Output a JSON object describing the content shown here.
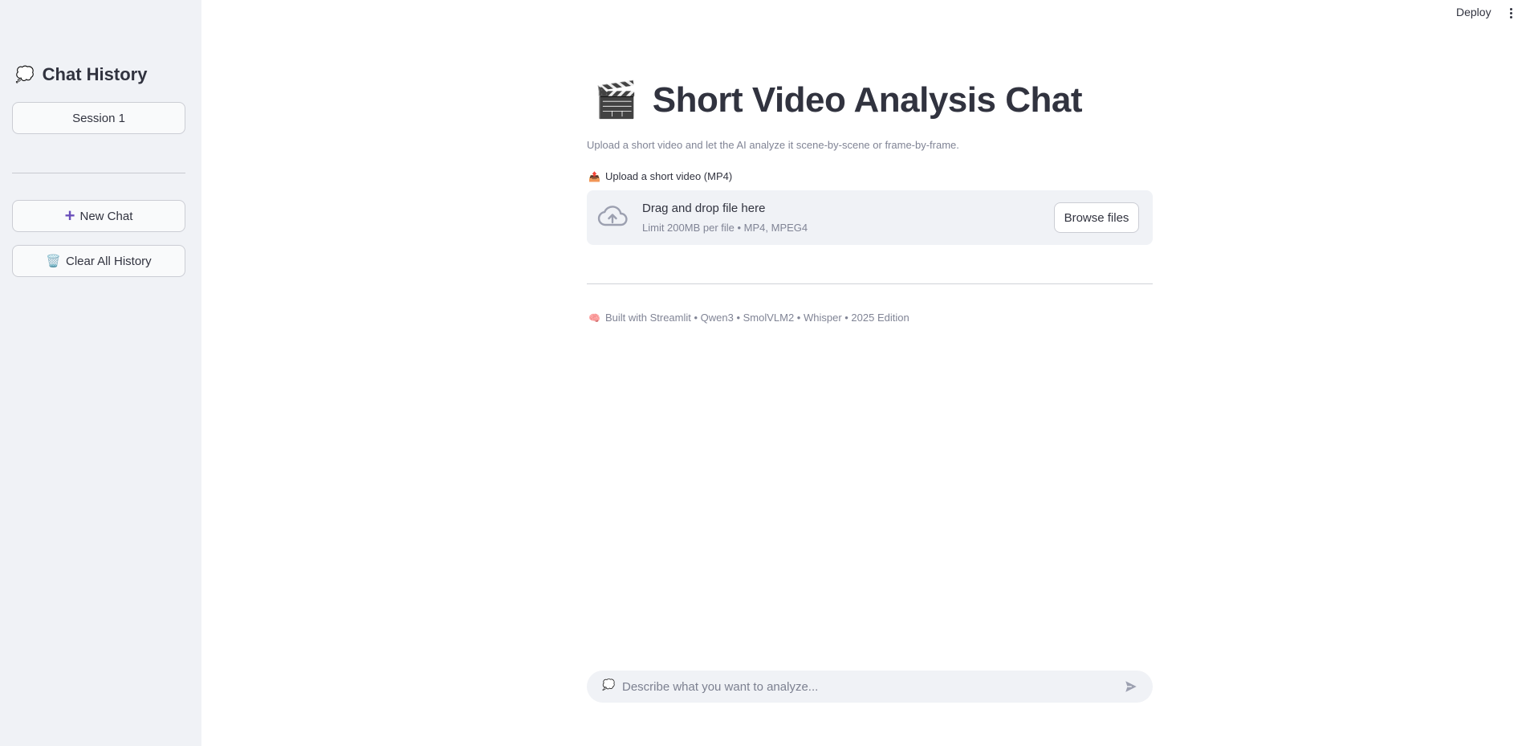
{
  "header": {
    "deploy_label": "Deploy"
  },
  "sidebar": {
    "title_emoji": "💭",
    "title": "Chat History",
    "sessions": [
      {
        "label": "Session 1"
      }
    ],
    "new_chat_label": "New Chat",
    "clear_history_emoji": "🗑️",
    "clear_history_label": "Clear All History"
  },
  "main": {
    "title_emoji": "🎬",
    "title": "Short Video Analysis Chat",
    "subtitle": "Upload a short video and let the AI analyze it scene-by-scene or frame-by-frame.",
    "upload": {
      "label_emoji": "📤",
      "label": "Upload a short video (MP4)",
      "dropzone_title": "Drag and drop file here",
      "dropzone_limits": "Limit 200MB per file • MP4, MPEG4",
      "browse_label": "Browse files"
    },
    "footer_emoji": "🧠",
    "footer_text": "Built with Streamlit • Qwen3 • SmolVLM2 • Whisper • 2025 Edition"
  },
  "chat_input": {
    "icon_emoji": "💭",
    "placeholder": "Describe what you want to analyze..."
  },
  "colors": {
    "sidebar_bg": "#f0f2f6",
    "text": "#31333f",
    "muted_text": "#808495",
    "accent": "#6b4fbb"
  },
  "icons": [
    "thought-bubble-icon",
    "plus-icon",
    "trash-icon",
    "clapper-icon",
    "outbox-icon",
    "cloud-upload-icon",
    "brain-icon",
    "send-icon",
    "kebab-menu-icon"
  ]
}
